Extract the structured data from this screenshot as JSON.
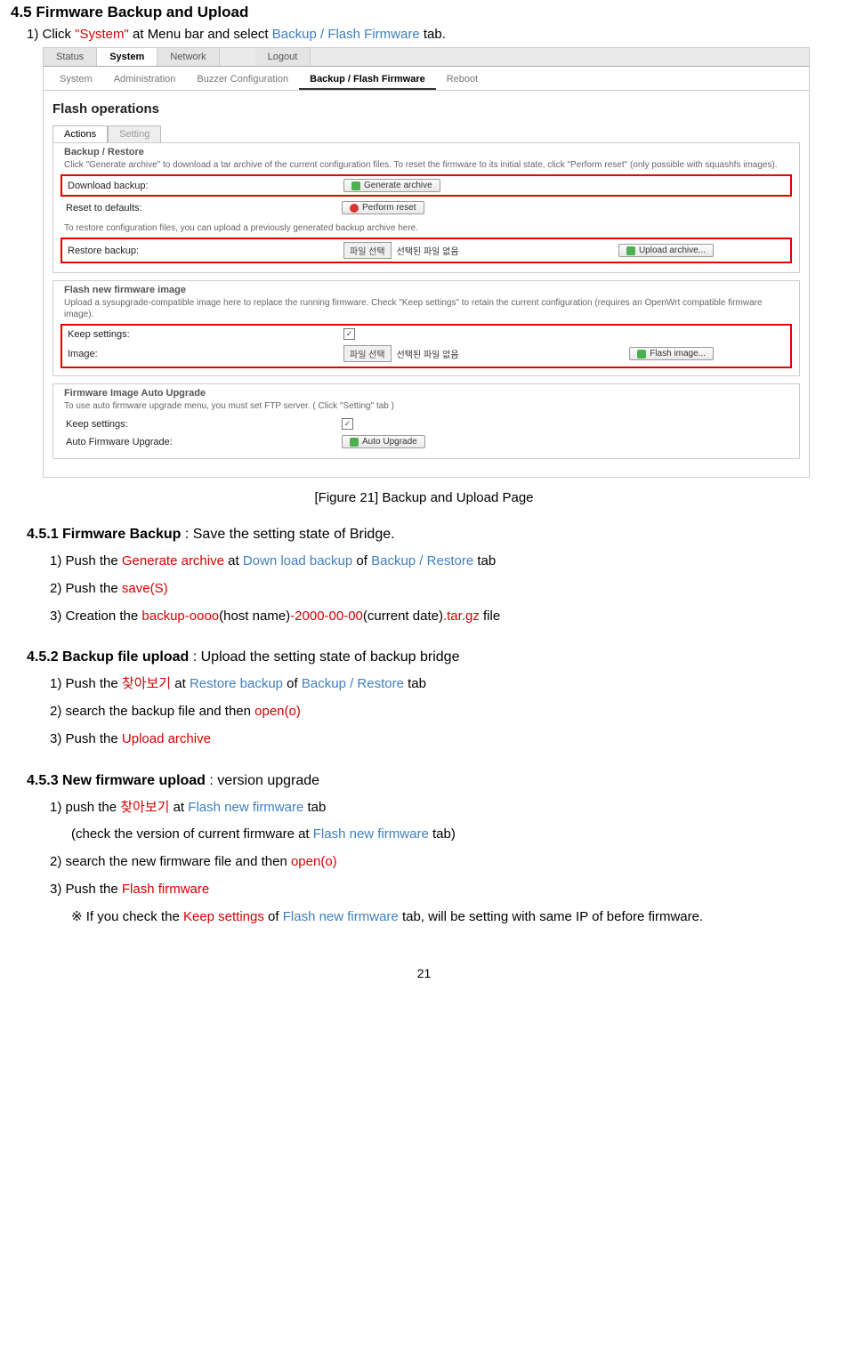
{
  "title": "4.5 Firmware Backup and Upload",
  "intro": {
    "p1a": "1) Click ",
    "p1b": "\"System\"",
    "p1c": " at Menu bar and select ",
    "p1d": "Backup / Flash Firmware",
    "p1e": " tab."
  },
  "screenshot": {
    "tabs": [
      "Status",
      "System",
      "Network",
      "Logout"
    ],
    "subtabs": [
      "System",
      "Administration",
      "Buzzer Configuration",
      "Backup / Flash Firmware",
      "Reboot"
    ],
    "heading": "Flash operations",
    "inner_tabs": [
      "Actions",
      "Setting"
    ],
    "fs1": {
      "title": "Backup / Restore",
      "desc": "Click \"Generate archive\" to download a tar archive of the current configuration files. To reset the firmware to its initial state, click \"Perform reset\" (only possible with squashfs images).",
      "r1_label": "Download backup:",
      "r1_btn": "Generate archive",
      "r2_label": "Reset to defaults:",
      "r2_btn": "Perform reset",
      "desc2": "To restore configuration files, you can upload a previously generated backup archive here.",
      "r3_label": "Restore backup:",
      "r3_file_btn": "파일 선택",
      "r3_file_txt": "선택된 파일 없음",
      "r3_btn": "Upload archive..."
    },
    "fs2": {
      "title": "Flash new firmware image",
      "desc": "Upload a sysupgrade-compatible image here to replace the running firmware. Check \"Keep settings\" to retain the current configuration (requires an OpenWrt compatible firmware image).",
      "r1_label": "Keep settings:",
      "r2_label": "Image:",
      "r2_file_btn": "파일 선택",
      "r2_file_txt": "선택된 파일 없음",
      "r2_btn": "Flash image..."
    },
    "fs3": {
      "title": "Firmware Image Auto Upgrade",
      "desc": "To use auto firmware upgrade menu, you must set FTP server. ( Click \"Setting\" tab )",
      "r1_label": "Keep settings:",
      "r2_label": "Auto Firmware Upgrade:",
      "r2_btn": "Auto Upgrade"
    }
  },
  "caption": "[Figure 21] Backup and Upload Page",
  "s451": {
    "num": "4.5.1 Firmware Backup",
    "desc": " : Save the setting state of Bridge.",
    "l1a": "1) Push the ",
    "l1b": "Generate archive",
    "l1c": " at ",
    "l1d": "Down load backup",
    "l1e": " of ",
    "l1f": "Backup / Restore",
    "l1g": " tab",
    "l2a": "2) Push the ",
    "l2b": "save(S)",
    "l3a": "3) Creation the ",
    "l3b": "backup-oooo",
    "l3c": "(host name)",
    "l3d": "-2000-00-00",
    "l3e": "(current date)",
    "l3f": ".tar.gz",
    "l3g": " file"
  },
  "s452": {
    "num": "4.5.2 Backup file upload",
    "desc": " : Upload the setting state of backup bridge",
    "l1a": "1) Push the ",
    "l1b": "찾아보기",
    "l1c": " at ",
    "l1d": "Restore backup",
    "l1e": " of ",
    "l1f": "Backup / Restore",
    "l1g": "  tab",
    "l2a": "2) search the backup file and then ",
    "l2b": "open(o)",
    "l3a": "3) Push the ",
    "l3b": "Upload archive"
  },
  "s453": {
    "num": "4.5.3 New firmware upload",
    "desc": " : version upgrade",
    "l1a": "1) push the ",
    "l1b": "찾아보기",
    "l1c": " at ",
    "l1d": "Flash new firmware",
    "l1e": "  tab",
    "l1n_a": "(check the version of current firmware at ",
    "l1n_b": "Flash new firmware",
    "l1n_c": " tab)",
    "l2a": "2) search the new firmware file and then ",
    "l2b": "open(o)",
    "l3a": "3) Push the ",
    "l3b": "Flash firmware",
    "l4a": "※ If you check the ",
    "l4b": "Keep settings",
    "l4c": " of ",
    "l4d": "Flash new firmware",
    "l4e": " tab, will be setting with same IP of before firmware."
  },
  "page": "21"
}
